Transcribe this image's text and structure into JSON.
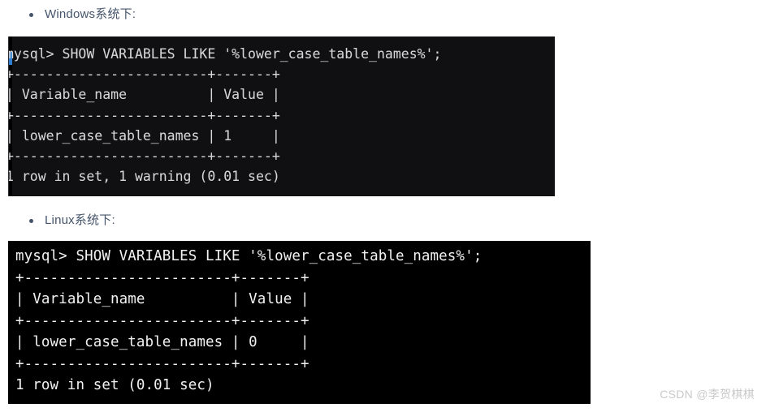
{
  "page": {
    "background": "#ffffff",
    "watermark": "CSDN @李贺棋棋",
    "text_color": "#44546b"
  },
  "sections": [
    {
      "bullet_label": "Windows系统下:",
      "terminal": {
        "background": "#101013",
        "foreground": "#d6d6d6",
        "prompt": "mysql>",
        "command": "SHOW VARIABLES LIKE '%lower_case_table_names%';",
        "full_text": "mysql> SHOW VARIABLES LIKE '%lower_case_table_names%';\n+------------------------+-------+\n| Variable_name          | Value |\n+------------------------+-------+\n| lower_case_table_names | 1     |\n+------------------------+-------+\n1 row in set, 1 warning (0.01 sec)",
        "table": {
          "headers": [
            "Variable_name",
            "Value"
          ],
          "rows": [
            [
              "lower_case_table_names",
              "1"
            ]
          ]
        },
        "status": "1 row in set, 1 warning (0.01 sec)",
        "row_count": 1,
        "warning_count": 1,
        "duration": "0.01 sec"
      }
    },
    {
      "bullet_label": "Linux系统下:",
      "terminal": {
        "background": "#000000",
        "foreground": "#f2f2f2",
        "prompt": "mysql>",
        "command": "SHOW VARIABLES LIKE '%lower_case_table_names%';",
        "full_text": "mysql> SHOW VARIABLES LIKE '%lower_case_table_names%';\n+------------------------+-------+\n| Variable_name          | Value |\n+------------------------+-------+\n| lower_case_table_names | 0     |\n+------------------------+-------+\n1 row in set (0.01 sec)",
        "table": {
          "headers": [
            "Variable_name",
            "Value"
          ],
          "rows": [
            [
              "lower_case_table_names",
              "0"
            ]
          ]
        },
        "status": "1 row in set (0.01 sec)",
        "row_count": 1,
        "warning_count": 0,
        "duration": "0.01 sec"
      }
    }
  ]
}
